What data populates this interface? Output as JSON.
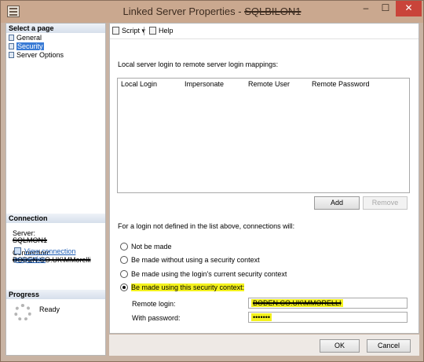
{
  "window": {
    "title": "Linked Server Properties -",
    "title_redacted": "SQLBILON1",
    "minimize_glyph": "–",
    "maximize_glyph": "☐",
    "close_glyph": "✕"
  },
  "left_panel": {
    "select_page_header": "Select a page",
    "pages": [
      {
        "label": "General",
        "icon": "page-icon",
        "selected": false
      },
      {
        "label": "Security",
        "icon": "page-icon",
        "selected": true
      },
      {
        "label": "Server Options",
        "icon": "page-icon",
        "selected": false
      }
    ],
    "connection_header": "Connection",
    "server_label": "Server:",
    "server_value": "SQLMON1",
    "connection_label": "Connection:",
    "connection_value": "BODEN.CO.UK\\MMorelli",
    "view_connection_link": "View connection properties",
    "progress_header": "Progress",
    "progress_status": "Ready"
  },
  "toolbar": {
    "script_label": "Script",
    "script_dropdown_glyph": "▾",
    "help_label": "Help"
  },
  "security": {
    "mappings_label": "Local server login to remote server login mappings:",
    "columns": [
      "Local Login",
      "Impersonate",
      "Remote User",
      "Remote Password"
    ],
    "rows": [],
    "add_button": "Add",
    "remove_button": "Remove",
    "fallback_label": "For a login not defined in the list above, connections will:",
    "options": [
      {
        "label": "Not be made",
        "checked": false
      },
      {
        "label": "Be made without using a security context",
        "checked": false
      },
      {
        "label": "Be made using the login's current security context",
        "checked": false
      },
      {
        "label": "Be made using this security context:",
        "checked": true
      }
    ],
    "remote_login_label": "Remote login:",
    "remote_login_value": "BODEN.CO.UK\\MMORELLI",
    "password_label": "With password:",
    "password_value": "•••••••"
  },
  "footer": {
    "ok_button": "OK",
    "cancel_button": "Cancel"
  },
  "colors": {
    "highlight": "#f4f21d",
    "selection": "#3a7bd5",
    "close_button": "#c9443a"
  }
}
